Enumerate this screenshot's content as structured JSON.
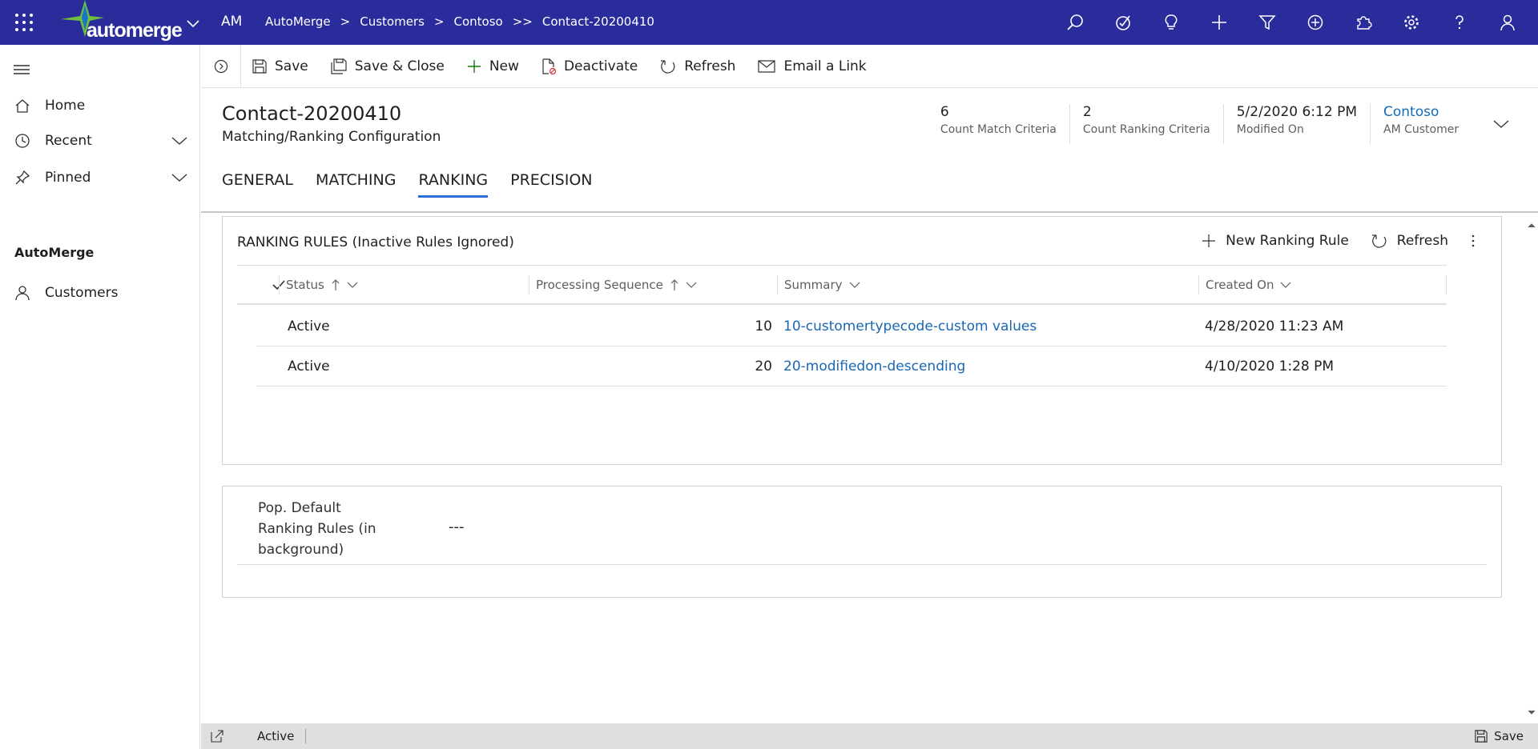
{
  "colors": {
    "topbar": "#2b2c9c",
    "accent": "#2b6fd6",
    "link": "#1866b5"
  },
  "app": {
    "logo": "automerge",
    "abbr": "AM",
    "breadcrumbs": [
      "AutoMerge",
      "Customers",
      "Contoso",
      "Contact-20200410"
    ]
  },
  "top_icons": [
    "search-icon",
    "task-icon",
    "lightbulb-icon",
    "plus-icon",
    "filter-icon",
    "circle-plus-icon",
    "puzzle-icon",
    "gear-icon",
    "help-icon",
    "user-icon"
  ],
  "nav": {
    "items": [
      {
        "label": "Home",
        "icon": "home-icon"
      },
      {
        "label": "Recent",
        "icon": "clock-icon"
      },
      {
        "label": "Pinned",
        "icon": "pin-icon"
      }
    ],
    "group": "AutoMerge",
    "group_items": [
      {
        "label": "Customers",
        "icon": "person-icon"
      }
    ]
  },
  "commands": [
    "Save",
    "Save & Close",
    "New",
    "Deactivate",
    "Refresh",
    "Email a Link"
  ],
  "record": {
    "title": "Contact-20200410",
    "subtitle": "Matching/Ranking Configuration",
    "fields": [
      {
        "value": "6",
        "label": "Count Match Criteria"
      },
      {
        "value": "2",
        "label": "Count Ranking Criteria"
      },
      {
        "value": "5/2/2020 6:12 PM",
        "label": "Modified On"
      },
      {
        "value": "Contoso",
        "label": "AM Customer"
      }
    ],
    "tabs": [
      "GENERAL",
      "MATCHING",
      "RANKING",
      "PRECISION"
    ],
    "active_tab": "RANKING"
  },
  "ranking": {
    "title": "RANKING RULES (Inactive Rules Ignored)",
    "new_label": "New Ranking Rule",
    "refresh_label": "Refresh",
    "columns": [
      "Status",
      "Processing Sequence",
      "Summary",
      "Created On"
    ],
    "rows": [
      {
        "status": "Active",
        "sequence": "10",
        "summary": "10-customertypecode-custom values",
        "created": "4/28/2020 11:23 AM"
      },
      {
        "status": "Active",
        "sequence": "20",
        "summary": "20-modifiedon-descending",
        "created": "4/10/2020 1:28 PM"
      }
    ]
  },
  "defaults": {
    "label": "Pop. Default Ranking Rules (in background)",
    "value": "---"
  },
  "statusbar": {
    "status": "Active",
    "save": "Save"
  }
}
